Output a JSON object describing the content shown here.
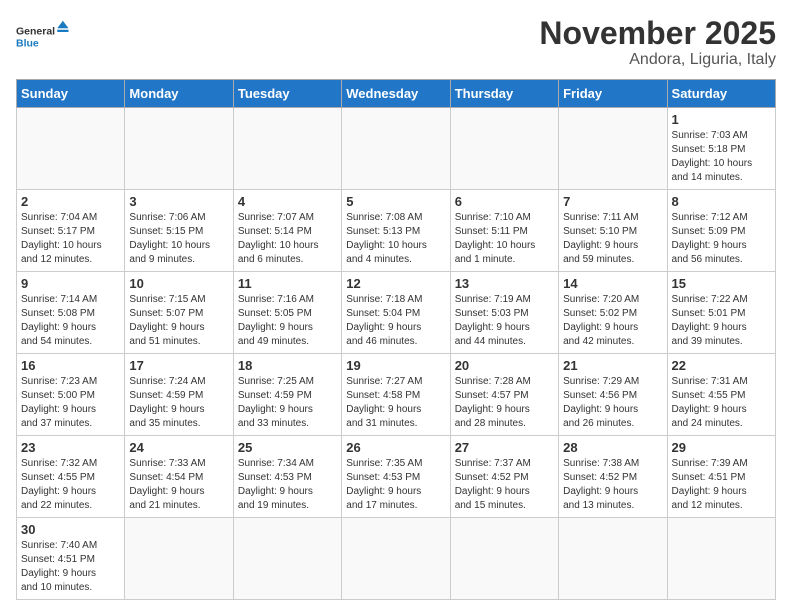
{
  "header": {
    "title": "November 2025",
    "subtitle": "Andora, Liguria, Italy",
    "logo_general": "General",
    "logo_blue": "Blue"
  },
  "weekdays": [
    "Sunday",
    "Monday",
    "Tuesday",
    "Wednesday",
    "Thursday",
    "Friday",
    "Saturday"
  ],
  "weeks": [
    [
      {
        "day": "",
        "info": ""
      },
      {
        "day": "",
        "info": ""
      },
      {
        "day": "",
        "info": ""
      },
      {
        "day": "",
        "info": ""
      },
      {
        "day": "",
        "info": ""
      },
      {
        "day": "",
        "info": ""
      },
      {
        "day": "1",
        "info": "Sunrise: 7:03 AM\nSunset: 5:18 PM\nDaylight: 10 hours\nand 14 minutes."
      }
    ],
    [
      {
        "day": "2",
        "info": "Sunrise: 7:04 AM\nSunset: 5:17 PM\nDaylight: 10 hours\nand 12 minutes."
      },
      {
        "day": "3",
        "info": "Sunrise: 7:06 AM\nSunset: 5:15 PM\nDaylight: 10 hours\nand 9 minutes."
      },
      {
        "day": "4",
        "info": "Sunrise: 7:07 AM\nSunset: 5:14 PM\nDaylight: 10 hours\nand 6 minutes."
      },
      {
        "day": "5",
        "info": "Sunrise: 7:08 AM\nSunset: 5:13 PM\nDaylight: 10 hours\nand 4 minutes."
      },
      {
        "day": "6",
        "info": "Sunrise: 7:10 AM\nSunset: 5:11 PM\nDaylight: 10 hours\nand 1 minute."
      },
      {
        "day": "7",
        "info": "Sunrise: 7:11 AM\nSunset: 5:10 PM\nDaylight: 9 hours\nand 59 minutes."
      },
      {
        "day": "8",
        "info": "Sunrise: 7:12 AM\nSunset: 5:09 PM\nDaylight: 9 hours\nand 56 minutes."
      }
    ],
    [
      {
        "day": "9",
        "info": "Sunrise: 7:14 AM\nSunset: 5:08 PM\nDaylight: 9 hours\nand 54 minutes."
      },
      {
        "day": "10",
        "info": "Sunrise: 7:15 AM\nSunset: 5:07 PM\nDaylight: 9 hours\nand 51 minutes."
      },
      {
        "day": "11",
        "info": "Sunrise: 7:16 AM\nSunset: 5:05 PM\nDaylight: 9 hours\nand 49 minutes."
      },
      {
        "day": "12",
        "info": "Sunrise: 7:18 AM\nSunset: 5:04 PM\nDaylight: 9 hours\nand 46 minutes."
      },
      {
        "day": "13",
        "info": "Sunrise: 7:19 AM\nSunset: 5:03 PM\nDaylight: 9 hours\nand 44 minutes."
      },
      {
        "day": "14",
        "info": "Sunrise: 7:20 AM\nSunset: 5:02 PM\nDaylight: 9 hours\nand 42 minutes."
      },
      {
        "day": "15",
        "info": "Sunrise: 7:22 AM\nSunset: 5:01 PM\nDaylight: 9 hours\nand 39 minutes."
      }
    ],
    [
      {
        "day": "16",
        "info": "Sunrise: 7:23 AM\nSunset: 5:00 PM\nDaylight: 9 hours\nand 37 minutes."
      },
      {
        "day": "17",
        "info": "Sunrise: 7:24 AM\nSunset: 4:59 PM\nDaylight: 9 hours\nand 35 minutes."
      },
      {
        "day": "18",
        "info": "Sunrise: 7:25 AM\nSunset: 4:59 PM\nDaylight: 9 hours\nand 33 minutes."
      },
      {
        "day": "19",
        "info": "Sunrise: 7:27 AM\nSunset: 4:58 PM\nDaylight: 9 hours\nand 31 minutes."
      },
      {
        "day": "20",
        "info": "Sunrise: 7:28 AM\nSunset: 4:57 PM\nDaylight: 9 hours\nand 28 minutes."
      },
      {
        "day": "21",
        "info": "Sunrise: 7:29 AM\nSunset: 4:56 PM\nDaylight: 9 hours\nand 26 minutes."
      },
      {
        "day": "22",
        "info": "Sunrise: 7:31 AM\nSunset: 4:55 PM\nDaylight: 9 hours\nand 24 minutes."
      }
    ],
    [
      {
        "day": "23",
        "info": "Sunrise: 7:32 AM\nSunset: 4:55 PM\nDaylight: 9 hours\nand 22 minutes."
      },
      {
        "day": "24",
        "info": "Sunrise: 7:33 AM\nSunset: 4:54 PM\nDaylight: 9 hours\nand 21 minutes."
      },
      {
        "day": "25",
        "info": "Sunrise: 7:34 AM\nSunset: 4:53 PM\nDaylight: 9 hours\nand 19 minutes."
      },
      {
        "day": "26",
        "info": "Sunrise: 7:35 AM\nSunset: 4:53 PM\nDaylight: 9 hours\nand 17 minutes."
      },
      {
        "day": "27",
        "info": "Sunrise: 7:37 AM\nSunset: 4:52 PM\nDaylight: 9 hours\nand 15 minutes."
      },
      {
        "day": "28",
        "info": "Sunrise: 7:38 AM\nSunset: 4:52 PM\nDaylight: 9 hours\nand 13 minutes."
      },
      {
        "day": "29",
        "info": "Sunrise: 7:39 AM\nSunset: 4:51 PM\nDaylight: 9 hours\nand 12 minutes."
      }
    ],
    [
      {
        "day": "30",
        "info": "Sunrise: 7:40 AM\nSunset: 4:51 PM\nDaylight: 9 hours\nand 10 minutes."
      },
      {
        "day": "",
        "info": ""
      },
      {
        "day": "",
        "info": ""
      },
      {
        "day": "",
        "info": ""
      },
      {
        "day": "",
        "info": ""
      },
      {
        "day": "",
        "info": ""
      },
      {
        "day": "",
        "info": ""
      }
    ]
  ]
}
